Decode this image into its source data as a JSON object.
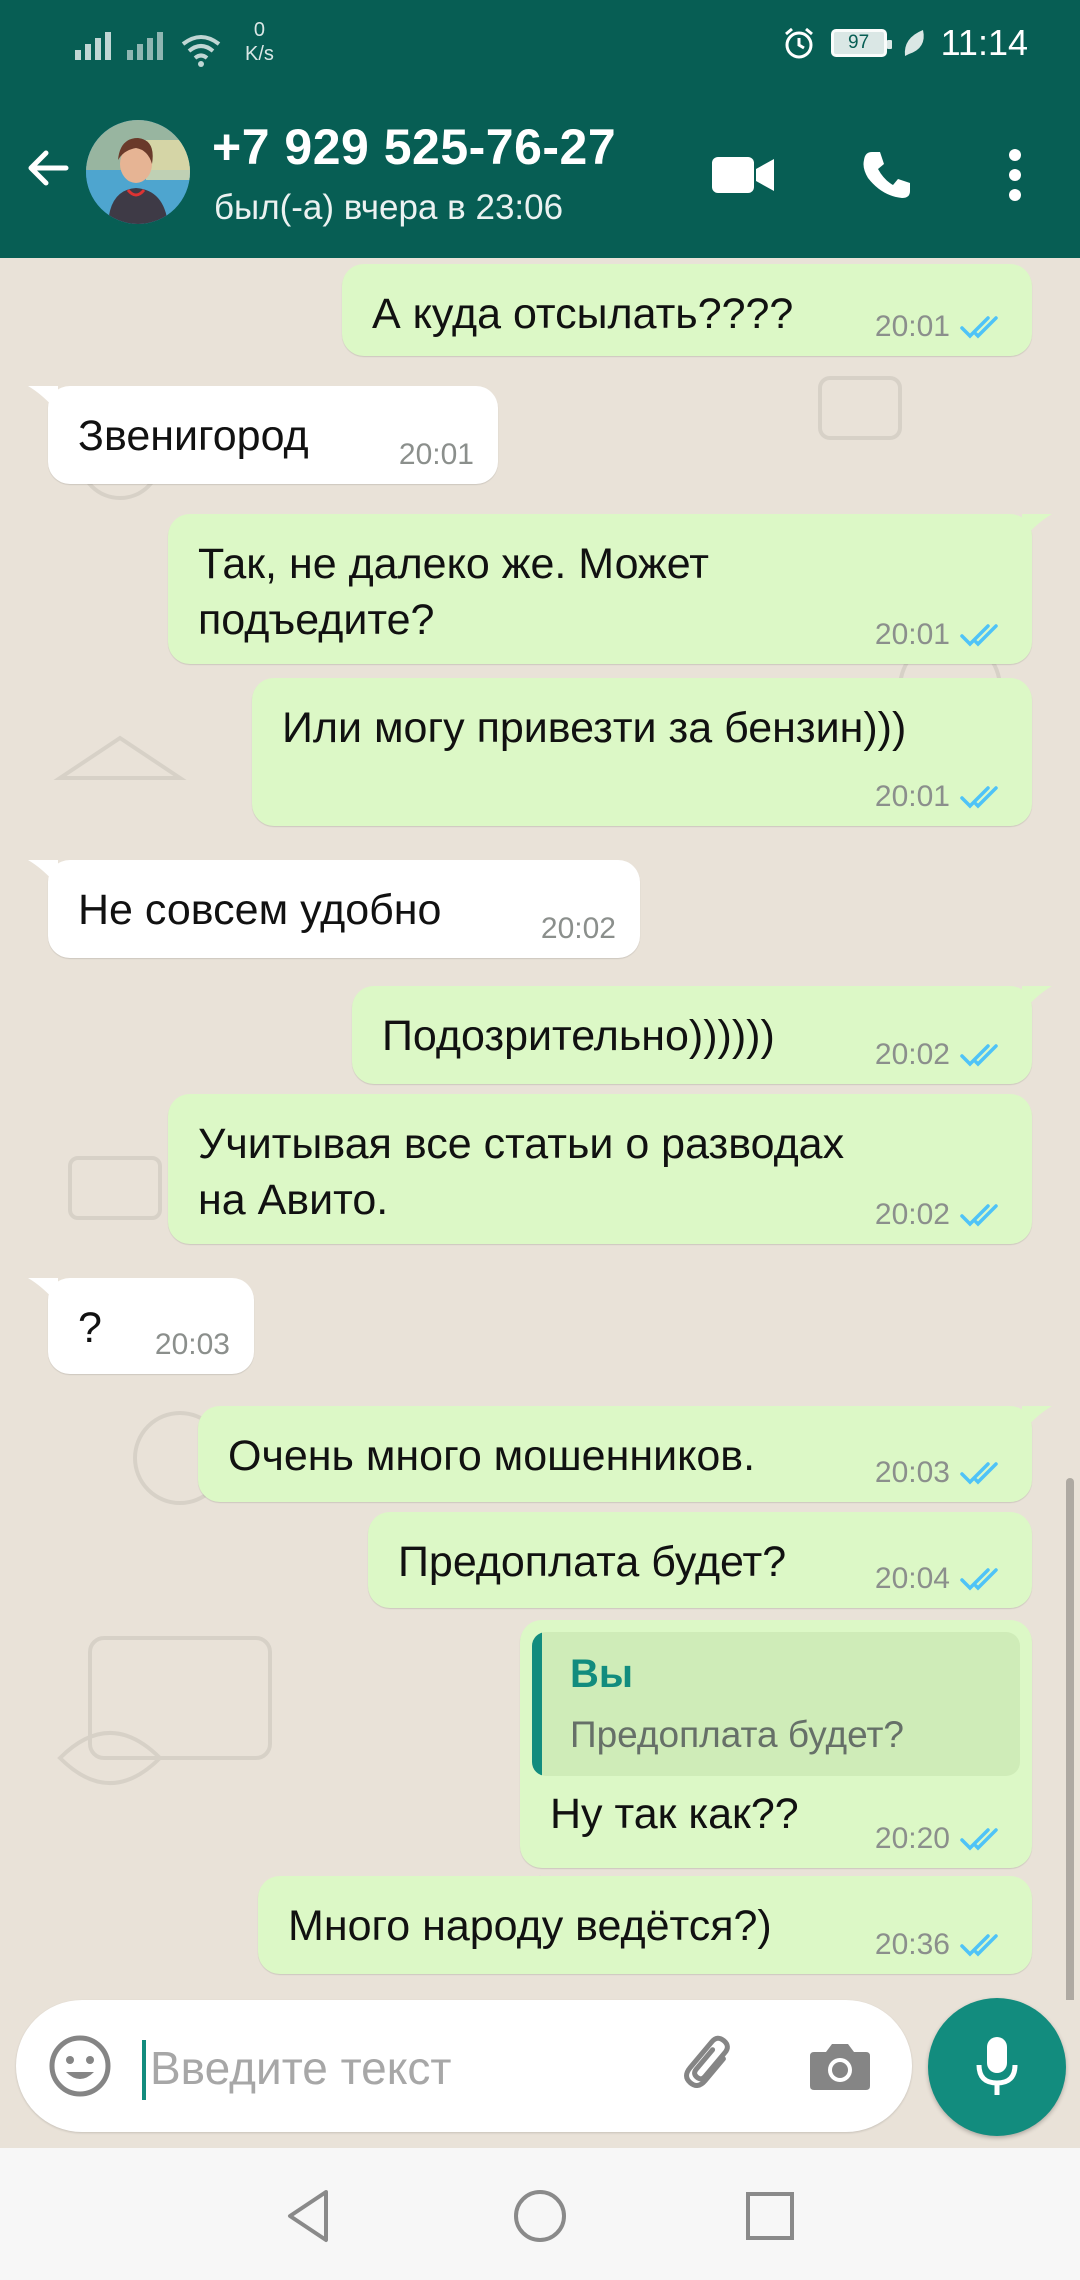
{
  "status_bar": {
    "net_speed_value": "0",
    "net_speed_unit": "K/s",
    "battery": "97",
    "time": "11:14",
    "icons": [
      "signal-icon",
      "signal-icon",
      "wifi-icon",
      "alarm-icon",
      "battery-icon",
      "leaf-icon"
    ]
  },
  "header": {
    "contact_name": "+7 929 525-76-27",
    "last_seen": "был(-а) вчера в 23:06",
    "icons": [
      "back-arrow-icon",
      "video-call-icon",
      "phone-icon",
      "more-vert-icon"
    ]
  },
  "messages": [
    {
      "dir": "out",
      "text": "А куда отсылать????",
      "time": "20:01",
      "ticks": "read"
    },
    {
      "dir": "in",
      "text": "Звенигород",
      "time": "20:01"
    },
    {
      "dir": "out",
      "text_lines": [
        "Так, не далеко же. Может",
        "подъедите?"
      ],
      "time": "20:01",
      "ticks": "read"
    },
    {
      "dir": "out",
      "text": "Или могу привезти за бензин)))",
      "time": "20:01",
      "ticks": "read"
    },
    {
      "dir": "in",
      "text": "Не совсем удобно",
      "time": "20:02"
    },
    {
      "dir": "out",
      "text": "Подозрительно))))))",
      "time": "20:02",
      "ticks": "read"
    },
    {
      "dir": "out",
      "text_lines": [
        "Учитывая все статьи о разводах",
        "на Авито."
      ],
      "time": "20:02",
      "ticks": "read"
    },
    {
      "dir": "in",
      "text": "?",
      "time": "20:03"
    },
    {
      "dir": "out",
      "text": "Очень много мошенников.",
      "time": "20:03",
      "ticks": "read"
    },
    {
      "dir": "out",
      "text": "Предоплата будет?",
      "time": "20:04",
      "ticks": "read"
    },
    {
      "dir": "out",
      "quote_author": "Вы",
      "quote_text": "Предоплата будет?",
      "text": "Ну так как??",
      "time": "20:20",
      "ticks": "read"
    },
    {
      "dir": "out",
      "text": "Много народу ведётся?)",
      "time": "20:36",
      "ticks": "read"
    }
  ],
  "composer": {
    "placeholder": "Введите текст",
    "icons": [
      "emoji-icon",
      "attach-icon",
      "camera-icon",
      "mic-icon"
    ]
  },
  "colors": {
    "header": "#075e54",
    "accent": "#128c7e",
    "outgoing_bubble": "#dcf8c6",
    "incoming_bubble": "#ffffff",
    "chat_bg": "#e9e2d8",
    "read_ticks": "#4fc3f7"
  },
  "nav_bar": {
    "icons": [
      "nav-back-icon",
      "nav-home-icon",
      "nav-recents-icon"
    ]
  }
}
